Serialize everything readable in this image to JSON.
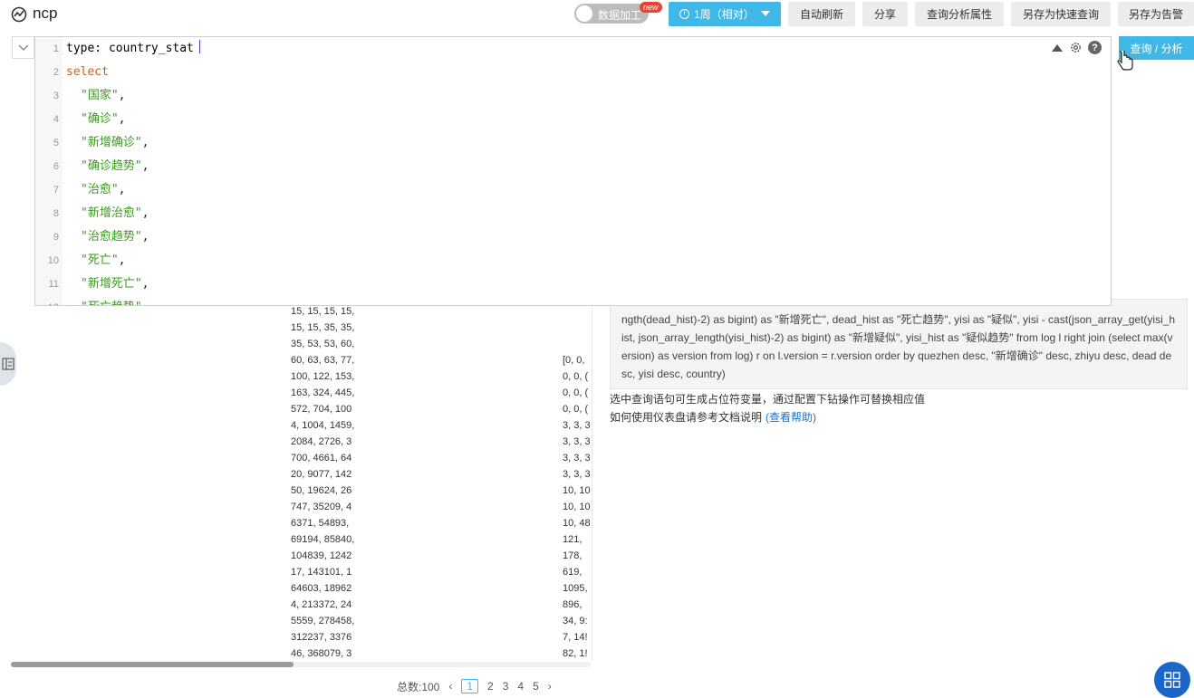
{
  "header": {
    "app_title": "ncp",
    "toggle_label": "数据加工",
    "new_badge": "new",
    "time_range": "1周（相对）",
    "buttons": [
      "自动刷新",
      "分享",
      "查询分析属性",
      "另存为快速查询",
      "另存为告警"
    ]
  },
  "editor": {
    "lines": [
      {
        "n": "1",
        "text": "type: country_stat",
        "kind": "type"
      },
      {
        "n": "2",
        "text": "select",
        "kind": "select"
      },
      {
        "n": "3",
        "text": "\"国家\"",
        "kind": "str"
      },
      {
        "n": "4",
        "text": "\"确诊\"",
        "kind": "str"
      },
      {
        "n": "5",
        "text": "\"新增确诊\"",
        "kind": "str"
      },
      {
        "n": "6",
        "text": "\"确诊趋势\"",
        "kind": "str"
      },
      {
        "n": "7",
        "text": "\"治愈\"",
        "kind": "str"
      },
      {
        "n": "8",
        "text": "\"新增治愈\"",
        "kind": "str"
      },
      {
        "n": "9",
        "text": "\"治愈趋势\"",
        "kind": "str"
      },
      {
        "n": "10",
        "text": "\"死亡\"",
        "kind": "str"
      },
      {
        "n": "11",
        "text": "\"新增死亡\"",
        "kind": "str"
      },
      {
        "n": "12",
        "text": "\"死亡趋势\"",
        "kind": "str"
      }
    ],
    "help_icon": "?",
    "run_button": "查询 / 分析"
  },
  "results": {
    "col1_header": "",
    "col2_header": "",
    "col1": [
      "15, 15, 15, 15,",
      "15, 15, 35, 35,",
      "35, 53, 53, 60,",
      "60, 63, 63, 77,",
      "100, 122, 153,",
      "163, 324, 445,",
      "572, 704, 100",
      "4, 1004, 1459,",
      "2084, 2726, 3",
      "700, 4661, 64",
      "20, 9077, 142",
      "50, 19624, 26",
      "747, 35209, 4",
      "6371, 54893,",
      "69194, 85840,",
      "104839, 1242",
      "17, 143101, 1",
      "64603, 18962",
      "4, 213372, 24",
      "5559, 278458,",
      "312237, 3376",
      "46, 368079, 3"
    ],
    "col2": [
      "",
      "",
      "",
      "[0, 0,",
      "0, 0, (",
      "0, 0, (",
      "0, 0, (",
      "3, 3, 3",
      "3, 3, 3",
      "3, 3, 3",
      "3, 3, 3",
      "10, 10",
      "10, 10",
      "10, 48",
      "121,",
      "178,",
      "619,",
      "1095,",
      "896,",
      "34, 9:",
      "7, 14!",
      "82, 1!"
    ]
  },
  "pagination": {
    "total_label": "总数:100",
    "pages": [
      "1",
      "2",
      "3",
      "4",
      "5"
    ],
    "current": "1"
  },
  "sql_preview": "ngth(dead_hist)-2) as bigint) as \"新增死亡\", dead_hist as \"死亡趋势\", yisi as \"疑似\", yisi - cast(json_array_get(yisi_hist, json_array_length(yisi_hist)-2) as bigint) as \"新增疑似\", yisi_hist as \"疑似趋势\" from log l right join (select max(version) as version from log) r on l.version = r.version order by quezhen desc, \"新增确诊\" desc, zhiyu desc, dead desc, yisi desc, country)",
  "notes": {
    "line1": "选中查询语句可生成占位符变量，通过配置下钻操作可替换相应值",
    "line2": "如何使用仪表盘请参考文档说明",
    "help_link": "(查看帮助)"
  },
  "colors": {
    "accent": "#3fb8e8",
    "keyword": "#c0642c",
    "string": "#3a9a1c",
    "link": "#1a73c8"
  }
}
